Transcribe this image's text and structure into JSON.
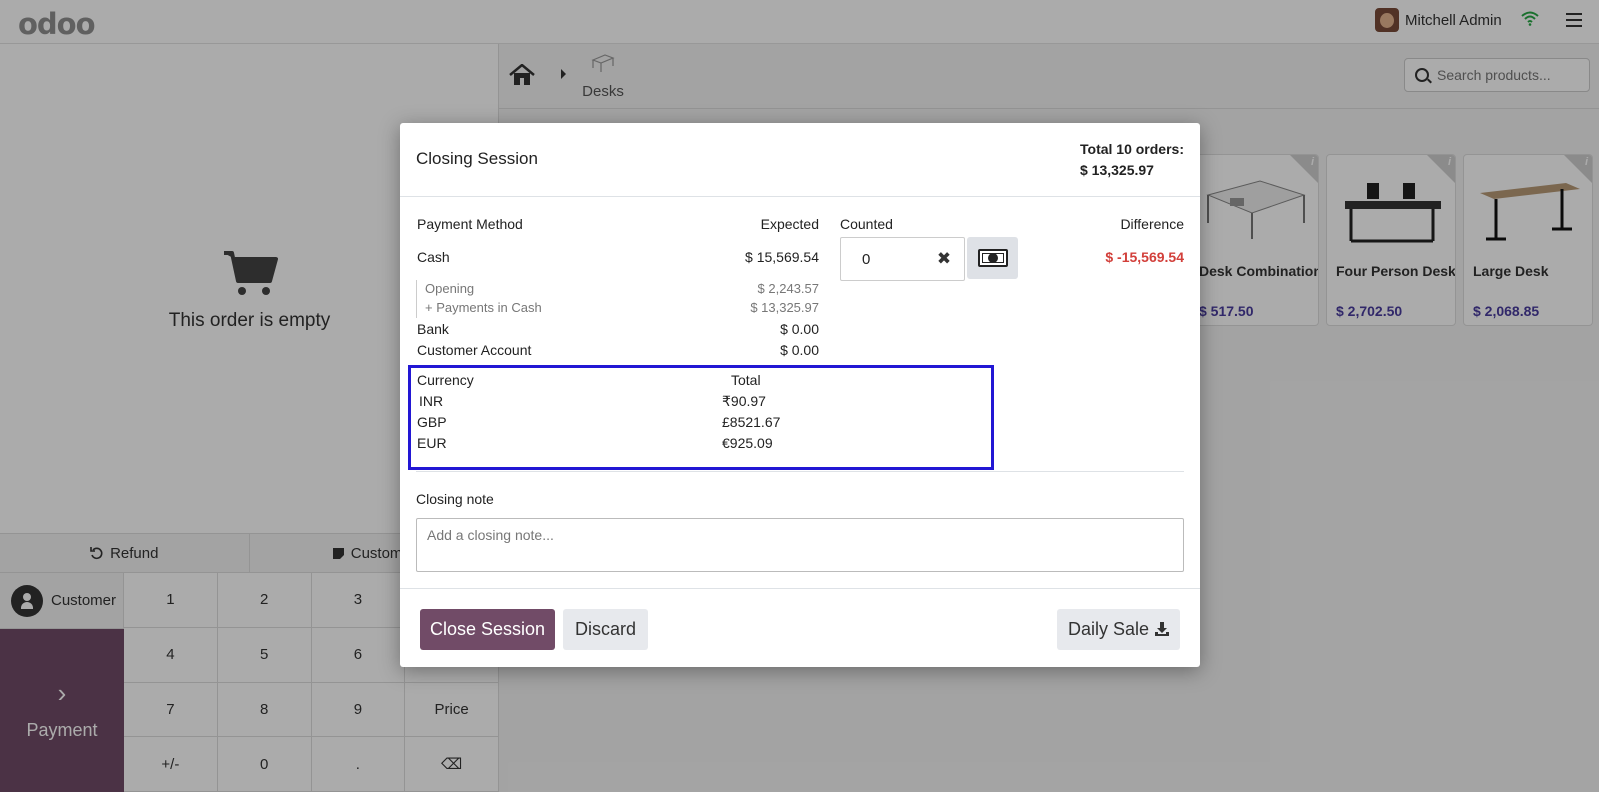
{
  "app": {
    "logo": "odoo",
    "user_name": "Mitchell Admin"
  },
  "left": {
    "empty_text": "This order is empty",
    "controls": [
      {
        "label": "Refund"
      },
      {
        "label": "Customer"
      }
    ],
    "customer_label": "Customer",
    "payment_label": "Payment",
    "numpad": [
      "1",
      "2",
      "3",
      "",
      "4",
      "5",
      "6",
      "",
      "7",
      "8",
      "9",
      "Price",
      "+/-",
      "0",
      ".",
      "⌫"
    ]
  },
  "catalog": {
    "breadcrumb": "Desks",
    "search_placeholder": "Search products...",
    "products": [
      {
        "name": "Desk Combination",
        "price": "$ 517.50"
      },
      {
        "name": "Four Person Desk",
        "price": "$ 2,702.50"
      },
      {
        "name": "Large Desk",
        "price": "$ 2,068.85"
      }
    ]
  },
  "modal": {
    "title": "Closing Session",
    "total_orders_label": "Total 10 orders:",
    "total_orders_amount": "$ 13,325.97",
    "headers": {
      "payment_method": "Payment Method",
      "expected": "Expected",
      "counted": "Counted",
      "difference": "Difference"
    },
    "cash": {
      "label": "Cash",
      "expected": "$ 15,569.54",
      "counted": "0",
      "difference": "$ -15,569.54",
      "opening_label": "Opening",
      "opening_amount": "$ 2,243.57",
      "payments_label": "+ Payments in Cash",
      "payments_amount": "$ 13,325.97"
    },
    "bank": {
      "label": "Bank",
      "expected": "$ 0.00"
    },
    "customer_account": {
      "label": "Customer Account",
      "expected": "$ 0.00"
    },
    "currency_table": {
      "header_currency": "Currency",
      "header_total": "Total",
      "rows": [
        {
          "currency": "INR",
          "total": "₹90.97"
        },
        {
          "currency": "GBP",
          "total": "£8521.67"
        },
        {
          "currency": "EUR",
          "total": "€925.09"
        }
      ]
    },
    "closing_note_label": "Closing note",
    "closing_note_placeholder": "Add a closing note...",
    "buttons": {
      "close_session": "Close Session",
      "discard": "Discard",
      "daily_sale": "Daily Sale"
    }
  },
  "colors": {
    "brand": "#714b67",
    "negative": "#d23f3a",
    "highlight_box": "#2217d4",
    "price": "#4a3d9e"
  }
}
